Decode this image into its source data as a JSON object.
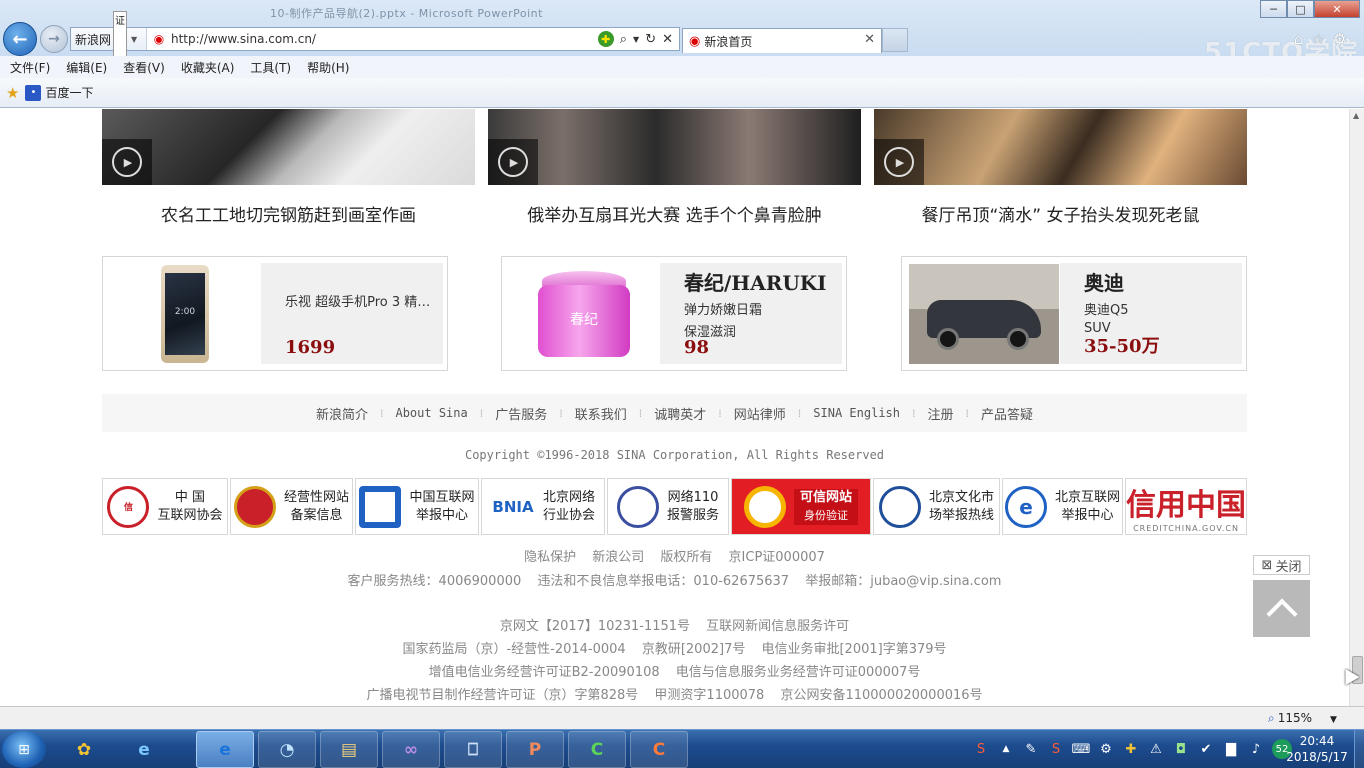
{
  "window": {
    "background_title": "10-制作产品导航(2).pptx - Microsoft PowerPoint",
    "minimize": "─",
    "maximize": "□",
    "close": "✕"
  },
  "address_bar": {
    "site_label": "新浪网",
    "site_badge": "证",
    "url": "http://www.sina.com.cn/"
  },
  "tab": {
    "title": "新浪首页",
    "close": "✕"
  },
  "menu": [
    "文件(F)",
    "编辑(E)",
    "查看(V)",
    "收藏夹(A)",
    "工具(T)",
    "帮助(H)"
  ],
  "favorites": {
    "item": "百度一下"
  },
  "watermark": "51CTO学院",
  "videos": [
    {
      "caption": "农名工工地切完钢筋赶到画室作画"
    },
    {
      "caption": "俄举办互扇耳光大赛 选手个个鼻青脸肿"
    },
    {
      "caption": "餐厅吊顶“滴水” 女子抬头发现死老鼠"
    }
  ],
  "ads": [
    {
      "brand": "",
      "line1": "乐视 超级手机Pro 3 精…",
      "line2": "",
      "price": "1699",
      "pic_text": "2:00"
    },
    {
      "brand": "春纪/HARUKI",
      "line1": "弹力娇嫩日霜",
      "line2": "保湿滋润",
      "price": "98",
      "pic_text": "春纪"
    },
    {
      "brand": "奥迪",
      "line1": "奥迪Q5",
      "line2": "SUV",
      "price": "35-50万",
      "pic_text": ""
    }
  ],
  "footer_links": [
    "新浪简介",
    "About Sina",
    "广告服务",
    "联系我们",
    "诚聘英才",
    "网站律师",
    "SINA English",
    "注册",
    "产品答疑"
  ],
  "copyright": "Copyright ©1996-2018 SINA Corporation, All Rights Reserved",
  "badges": [
    {
      "emblem": "信",
      "line1": "中 国",
      "line2": "互联网协会"
    },
    {
      "emblem": "",
      "line1": "经营性网站",
      "line2": "备案信息"
    },
    {
      "emblem": "",
      "line1": "中国互联网",
      "line2": "举报中心"
    },
    {
      "emblem": "BNIA",
      "line1": "北京网络",
      "line2": "行业协会"
    },
    {
      "emblem": "",
      "line1": "网络110",
      "line2": "报警服务"
    },
    {
      "emblem": "",
      "line1": "可信网站",
      "line2": "身份验证"
    },
    {
      "emblem": "",
      "line1": "北京文化市",
      "line2": "场举报热线"
    },
    {
      "emblem": "e",
      "line1": "北京互联网",
      "line2": "举报中心"
    },
    {
      "emblem": "",
      "line1": "信用中国",
      "line2": "CREDITCHINA.GOV.CN"
    }
  ],
  "legal": {
    "row1": [
      "隐私保护",
      "新浪公司",
      "版权所有",
      "京ICP证000007"
    ],
    "row2": [
      "客户服务热线：4006900000",
      "违法和不良信息举报电话：010-62675637",
      "举报邮箱：jubao@vip.sina.com"
    ],
    "row3": [
      "京网文【2017】10231-1151号",
      "互联网新闻信息服务许可"
    ],
    "row4": [
      "国家药监局（京）-经营性-2014-0004",
      "京教研[2002]7号",
      "电信业务审批[2001]字第379号"
    ],
    "row5": [
      "增值电信业务经营许可证B2-20090108",
      "电信与信息服务业务经营许可证000007号"
    ],
    "row6": [
      "广播电视节目制作经营许可证（京）字第828号",
      "甲测资字1100078",
      "京公网安备110000020000016号"
    ]
  },
  "floating": {
    "close_ad": "关闭"
  },
  "status": {
    "zoom": "115%"
  },
  "tray": {
    "badge": "52"
  },
  "clock": {
    "time": "20:44",
    "date": "2018/5/17"
  }
}
